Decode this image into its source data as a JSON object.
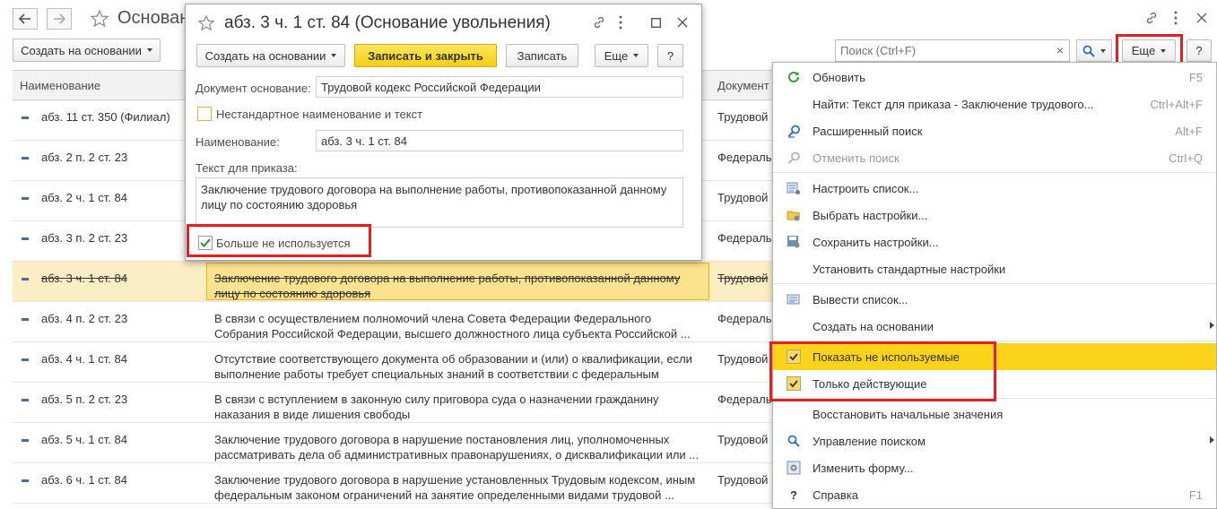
{
  "main": {
    "title": "Основан",
    "create_based_label": "Создать на основании",
    "search_placeholder": "Поиск (Ctrl+F)",
    "search_clear": "×",
    "more_label": "Еще",
    "help_label": "?"
  },
  "table": {
    "col_name": "Наименование",
    "col_doc": "Документ",
    "rows": [
      {
        "name": "абз. 11 ст. 350 (Филиал)",
        "text": "",
        "doc": "Трудовой"
      },
      {
        "name": "абз. 2 п. 2 ст. 23",
        "text": "",
        "doc": "Федераль"
      },
      {
        "name": "абз. 2 ч. 1 ст. 84",
        "text": "",
        "doc": "Трудовой"
      },
      {
        "name": "абз. 3 п. 2 ст. 23",
        "text": "",
        "doc": "Федераль"
      },
      {
        "name": "абз. 3 ч. 1 ст. 84",
        "text": "Заключение трудового договора на выполнение работы, противопоказанной данному\nлицу по состоянию здоровья",
        "doc": "Трудовой"
      },
      {
        "name": "абз. 4 п. 2 ст. 23",
        "text": "В связи с осуществлением полномочий члена Совета Федерации Федерального\nСобрания Российской Федерации, высшего должностного лица субъекта Российской ...",
        "doc": "Федераль"
      },
      {
        "name": "абз. 4 ч. 1 ст. 84",
        "text": "Отсутствие соответствующего документа об образовании  и (или) о квалификации, если\nвыполнение работы требует специальных знаний в соответствии с федеральным законо...",
        "doc": "Трудовой"
      },
      {
        "name": "абз. 5 п. 2 ст. 23",
        "text": "В связи с вступлением в законную силу приговора суда о назначении гражданину\nнаказания в виде лишения свободы",
        "doc": "Федераль"
      },
      {
        "name": "абз. 5 ч. 1 ст. 84",
        "text": "Заключение трудового договора в нарушение постановления лиц, уполномоченных\nрассматривать дела об административных правонарушениях, о дисквалификации или ...",
        "doc": "Трудовой"
      },
      {
        "name": "абз. 6 ч. 1 ст. 84",
        "text": "Заключение трудового договора в нарушение установленных Трудовым кодексом, иным\nфедеральным законом ограничений на занятие определенными видами трудовой ...",
        "doc": "Трудовой"
      }
    ]
  },
  "dialog": {
    "title": "абз. 3 ч. 1 ст. 84 (Основание увольнения)",
    "create_based_label": "Создать на основании",
    "save_close_label": "Записать и закрыть",
    "save_label": "Записать",
    "more_label": "Еще",
    "help_label": "?",
    "doc_label": "Документ основание:",
    "doc_value": "Трудовой кодекс Российской Федерации",
    "nonstandard_label": "Нестандартное наименование и текст",
    "nonstandard_checked": false,
    "name_label": "Наименование:",
    "name_value": "абз. 3 ч. 1 ст. 84",
    "order_text_label": "Текст для приказа:",
    "order_text_value": "Заключение трудового договора на выполнение работы, противопоказанной данному лицу по состоянию здоровья",
    "not_used_label": "Больше не используется",
    "not_used_checked": true
  },
  "menu": {
    "items": [
      {
        "label": "Обновить",
        "shortcut": "F5",
        "icon": "refresh-icon"
      },
      {
        "label": "Найти: Текст для приказа - Заключение трудового...",
        "shortcut": "Ctrl+Alt+F",
        "icon": ""
      },
      {
        "label": "Расширенный поиск",
        "shortcut": "Alt+F",
        "icon": "advanced-search-icon"
      },
      {
        "label": "Отменить поиск",
        "shortcut": "Ctrl+Q",
        "icon": "cancel-search-icon"
      },
      {
        "label": "Настроить список...",
        "shortcut": "",
        "icon": "list-settings-icon"
      },
      {
        "label": "Выбрать настройки...",
        "shortcut": "",
        "icon": "folder-settings-icon"
      },
      {
        "label": "Сохранить настройки...",
        "shortcut": "",
        "icon": "save-settings-icon"
      },
      {
        "label": "Установить стандартные настройки",
        "shortcut": "",
        "icon": ""
      },
      {
        "label": "Вывести список...",
        "shortcut": "",
        "icon": "print-list-icon"
      },
      {
        "label": "Создать на основании",
        "shortcut": "",
        "icon": ""
      },
      {
        "label": "Показать не используемые",
        "shortcut": "",
        "icon": "check-icon"
      },
      {
        "label": "Только действующие",
        "shortcut": "",
        "icon": "check-icon"
      },
      {
        "label": "Восстановить начальные значения",
        "shortcut": "",
        "icon": ""
      },
      {
        "label": "Управление поиском",
        "shortcut": "",
        "icon": "search-icon"
      },
      {
        "label": "Изменить форму...",
        "shortcut": "",
        "icon": "change-form-icon"
      },
      {
        "label": "Справка",
        "shortcut": "F1",
        "icon": "help-icon"
      }
    ]
  },
  "colors": {
    "accent_yellow": "#fcd31b",
    "highlight_red": "#e31f26",
    "selected_row": "#fbeec3"
  }
}
